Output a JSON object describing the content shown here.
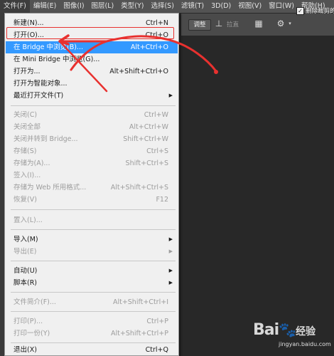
{
  "menubar": {
    "items": [
      "文件(F)",
      "编辑(E)",
      "图像(I)",
      "图层(L)",
      "类型(Y)",
      "选择(S)",
      "滤镜(T)",
      "3D(D)",
      "视图(V)",
      "窗口(W)",
      "帮助(H)"
    ]
  },
  "options_bar": {
    "button1": "调整",
    "text1": "拉直",
    "checkbox_label": "删除裁剪的"
  },
  "file_menu": {
    "items": [
      {
        "label": "新建(N)...",
        "shortcut": "Ctrl+N"
      },
      {
        "label": "打开(O)...",
        "shortcut": "Ctrl+O"
      },
      {
        "label": "在 Bridge 中浏览(B)...",
        "shortcut": "Alt+Ctrl+O"
      },
      {
        "label": "在 Mini Bridge 中浏览(G)...",
        "shortcut": ""
      },
      {
        "label": "打开为...",
        "shortcut": "Alt+Shift+Ctrl+O"
      },
      {
        "label": "打开为智能对象...",
        "shortcut": ""
      },
      {
        "label": "最近打开文件(T)",
        "shortcut": ""
      },
      {
        "label": "关闭(C)",
        "shortcut": "Ctrl+W"
      },
      {
        "label": "关闭全部",
        "shortcut": "Alt+Ctrl+W"
      },
      {
        "label": "关闭并转到 Bridge...",
        "shortcut": "Shift+Ctrl+W"
      },
      {
        "label": "存储(S)",
        "shortcut": "Ctrl+S"
      },
      {
        "label": "存储为(A)...",
        "shortcut": "Shift+Ctrl+S"
      },
      {
        "label": "签入(I)...",
        "shortcut": ""
      },
      {
        "label": "存储为 Web 所用格式...",
        "shortcut": "Alt+Shift+Ctrl+S"
      },
      {
        "label": "恢复(V)",
        "shortcut": "F12"
      },
      {
        "label": "置入(L)...",
        "shortcut": ""
      },
      {
        "label": "导入(M)",
        "shortcut": ""
      },
      {
        "label": "导出(E)",
        "shortcut": ""
      },
      {
        "label": "自动(U)",
        "shortcut": ""
      },
      {
        "label": "脚本(R)",
        "shortcut": ""
      },
      {
        "label": "文件简介(F)...",
        "shortcut": "Alt+Shift+Ctrl+I"
      },
      {
        "label": "打印(P)...",
        "shortcut": "Ctrl+P"
      },
      {
        "label": "打印一份(Y)",
        "shortcut": "Alt+Shift+Ctrl+P"
      },
      {
        "label": "退出(X)",
        "shortcut": "Ctrl+Q"
      }
    ]
  },
  "watermark": {
    "brand_a": "Bai",
    "brand_b": "经验",
    "site": "jingyan.baidu.com"
  },
  "colors": {
    "highlight": "#3399ff",
    "annotation": "#e8312f"
  }
}
